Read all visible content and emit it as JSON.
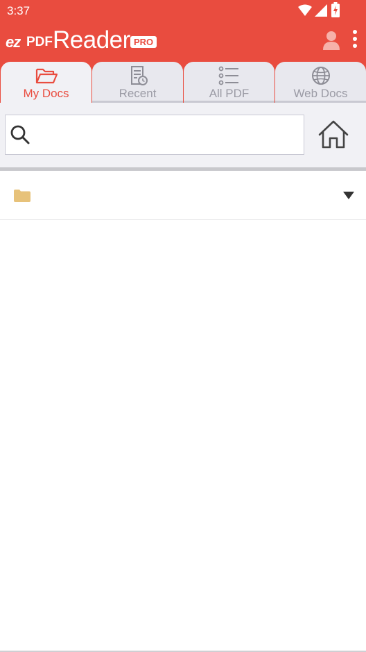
{
  "status_bar": {
    "time": "3:37",
    "icons": [
      "wifi-icon",
      "signal-icon",
      "battery-charging-icon"
    ]
  },
  "app_bar": {
    "logo": {
      "ez": "ez",
      "pdf": "PDF",
      "reader": "Reader",
      "badge": "PRO"
    },
    "actions": [
      "profile-icon",
      "more-vert-icon"
    ]
  },
  "tabs": [
    {
      "label": "My Docs",
      "icon": "folder-open-icon",
      "active": true
    },
    {
      "label": "Recent",
      "icon": "document-clock-icon",
      "active": false
    },
    {
      "label": "All PDF",
      "icon": "list-icon",
      "active": false
    },
    {
      "label": "Web Docs",
      "icon": "globe-icon",
      "active": false
    }
  ],
  "search": {
    "value": "",
    "placeholder": ""
  },
  "folder_row": {
    "path_label": "",
    "icon": "folder-icon",
    "dropdown": "dropdown-arrow-icon"
  },
  "colors": {
    "brand": "#e94c3f",
    "tab_bg": "#e8e8ee",
    "tab_active_bg": "#f1f1f5",
    "tab_inactive_text": "#9b9ba5",
    "folder": "#e7c27a"
  }
}
